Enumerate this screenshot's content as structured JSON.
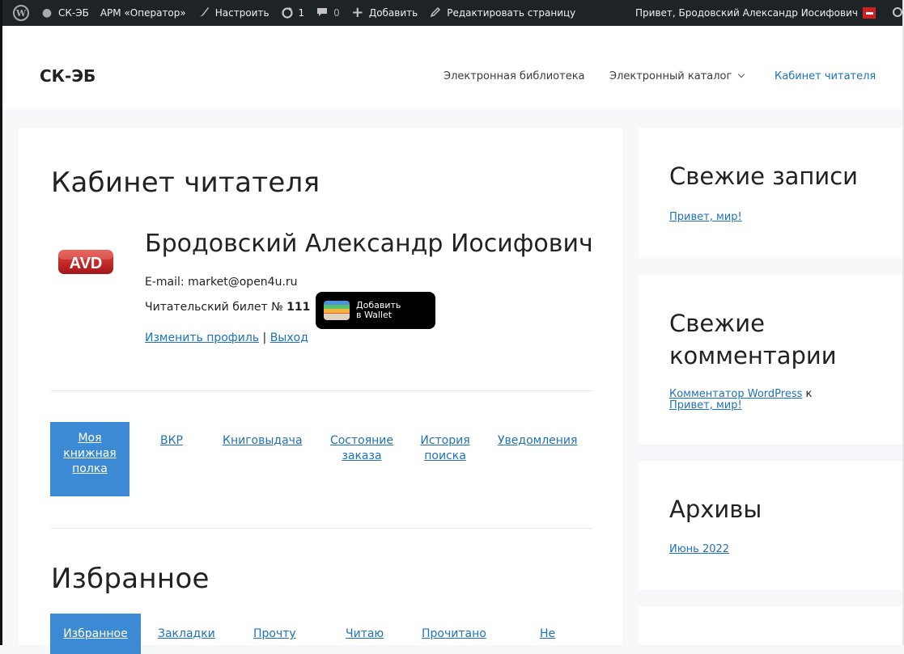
{
  "adminbar": {
    "site_name": "СК-ЭБ",
    "arm": "АРМ «Оператор»",
    "customize": "Настроить",
    "updates": "1",
    "comments": "0",
    "add_new": "Добавить",
    "edit_page": "Редактировать страницу",
    "greeting": "Привет, Бродовский Александр Иосифович"
  },
  "header": {
    "site_title": "СК-ЭБ",
    "nav": {
      "library": "Электронная библиотека",
      "catalog": "Электронный каталог",
      "cabinet": "Кабинет читателя"
    }
  },
  "main": {
    "page_title": "Кабинет читателя",
    "logo_text": "AVD",
    "profile_name": "Бродовский Александр Иосифович",
    "email_label": "E-mail: ",
    "email": "market@open4u.ru",
    "card_label": "Читательский билет № ",
    "card_number": "111",
    "wallet_line1": "Добавить",
    "wallet_line2": "в Wallet",
    "edit_profile": "Изменить профиль",
    "separator": " | ",
    "logout": "Выход",
    "tabs": {
      "shelf_1": "Моя",
      "shelf_2": "книжная",
      "shelf_3": "полка",
      "vkr": "ВКР",
      "issue": "Книговыдача",
      "order_1": "Состояние",
      "order_2": "заказа",
      "history_1": "История",
      "history_2": "поиска",
      "notifications": "Уведомления"
    },
    "favorites_title": "Избранное",
    "sub_tabs": {
      "favorites": "Избранное",
      "bookmarks": "Закладки",
      "will_read": "Прочту",
      "reading": "Читаю",
      "read": "Прочитано",
      "not": "Не"
    }
  },
  "sidebar": {
    "recent_posts_title": "Свежие записи",
    "recent_post_link": "Привет, мир!",
    "recent_comments_title_1": "Свежие",
    "recent_comments_title_2": "комментарии",
    "comment_author": "Комментатор WordPress",
    "comment_on": " к",
    "comment_post": "Привет, мир!",
    "archives_title": "Архивы",
    "archive_link": "Июнь 2022"
  },
  "colors": {
    "accent": "#1e72bd",
    "active_tab": "#3c8ad4",
    "adminbar": "#1d2327"
  }
}
